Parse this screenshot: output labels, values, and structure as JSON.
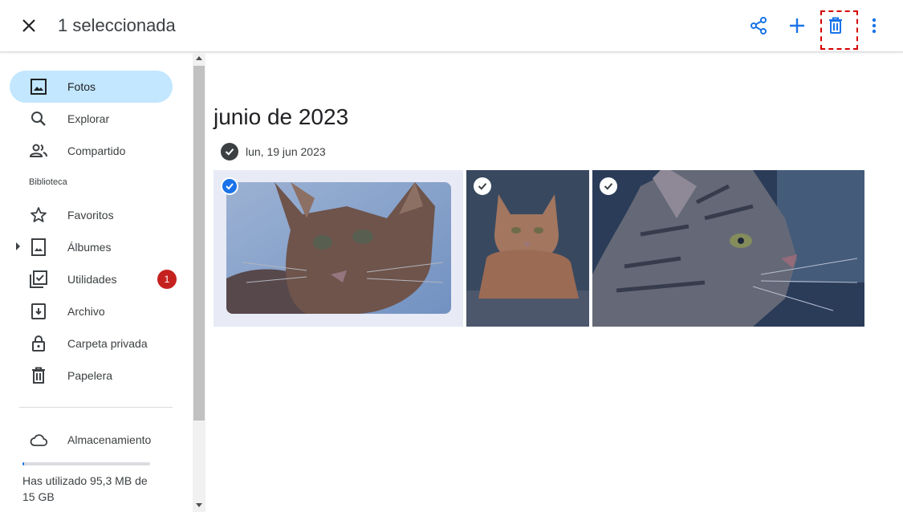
{
  "header": {
    "title": "1 seleccionada",
    "close_icon": "close-icon",
    "actions": [
      {
        "name": "share",
        "icon": "share-icon",
        "color": "#1a73e8"
      },
      {
        "name": "add",
        "icon": "plus-icon",
        "color": "#1a73e8"
      },
      {
        "name": "delete",
        "icon": "trash-icon",
        "color": "#1a73e8"
      },
      {
        "name": "more",
        "icon": "more-vert-icon",
        "color": "#1a73e8"
      }
    ]
  },
  "sidebar": {
    "items": [
      {
        "label": "Fotos",
        "icon": "photo-icon",
        "active": true
      },
      {
        "label": "Explorar",
        "icon": "search-icon"
      },
      {
        "label": "Compartido",
        "icon": "people-icon"
      }
    ],
    "library_label": "Biblioteca",
    "library_items": [
      {
        "label": "Favoritos",
        "icon": "star-icon"
      },
      {
        "label": "Álbumes",
        "icon": "album-icon"
      },
      {
        "label": "Utilidades",
        "icon": "utilities-icon",
        "badge": "1"
      },
      {
        "label": "Archivo",
        "icon": "archive-icon"
      },
      {
        "label": "Carpeta privada",
        "icon": "lock-icon"
      },
      {
        "label": "Papelera",
        "icon": "trash-icon"
      }
    ],
    "storage": {
      "label": "Almacenamiento",
      "icon": "cloud-icon",
      "used_text": "Has utilizado 95,3 MB de 15 GB",
      "used_fraction": 0.006
    }
  },
  "main": {
    "month": "junio de 2023",
    "date": "lun, 19 jun 2023",
    "photos": [
      {
        "subject": "cat-abyssinian",
        "selected": true
      },
      {
        "subject": "cat-orange",
        "selected": false
      },
      {
        "subject": "cat-tabby",
        "selected": false
      }
    ]
  },
  "colors": {
    "accent": "#1a73e8",
    "active_nav": "#c2e7ff",
    "badge": "#c5221f",
    "highlight": "#d50000"
  }
}
